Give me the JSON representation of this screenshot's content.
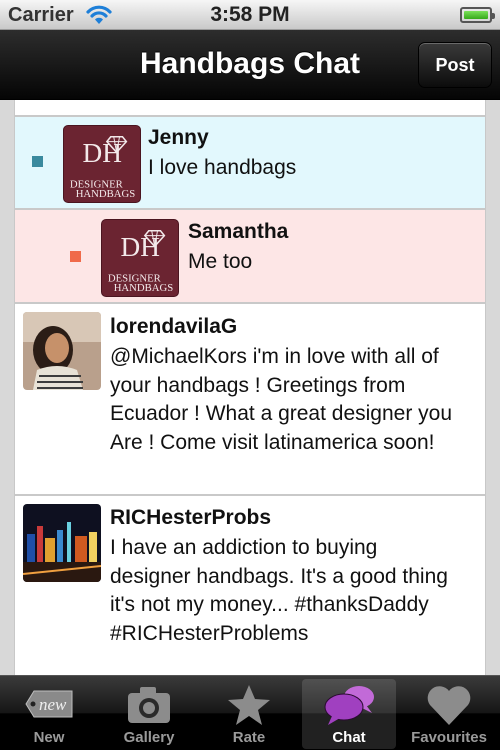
{
  "status_bar": {
    "carrier": "Carrier",
    "time": "3:58 PM"
  },
  "nav": {
    "title": "Handbags Chat",
    "post_label": "Post"
  },
  "logo_text": {
    "monogram": "DH",
    "line1": "DESIGNER",
    "line2": "HANDBAGS"
  },
  "messages": [
    {
      "name": "Jenny",
      "text": "I love handbags",
      "bullet_color": "#3a8a9e",
      "avatar": "designer-handbags-logo"
    },
    {
      "name": "Samantha",
      "text": "Me too",
      "bullet_color": "#f06a4a",
      "avatar": "designer-handbags-logo"
    },
    {
      "name": "lorendavilaG",
      "text_lines": [
        "@MichaelKors i'm in love with all of",
        "your handbags ! Greetings from",
        "Ecuador ! What a great designer you",
        "Are ! Come visit latinamerica soon!"
      ],
      "avatar": "user-photo"
    },
    {
      "name": "RICHesterProbs",
      "text_lines": [
        "I have an addiction to buying",
        "designer handbags. It's a good thing",
        "it's not my money... #thanksDaddy",
        "#RICHesterProblems"
      ],
      "avatar": "city-night-photo"
    }
  ],
  "tabs": [
    {
      "label": "New",
      "icon": "new-tag-icon",
      "active": false
    },
    {
      "label": "Gallery",
      "icon": "camera-icon",
      "active": false
    },
    {
      "label": "Rate",
      "icon": "star-icon",
      "active": false
    },
    {
      "label": "Chat",
      "icon": "chat-bubbles-icon",
      "active": true
    },
    {
      "label": "Favourites",
      "icon": "heart-icon",
      "active": false
    }
  ],
  "new_tag_text": "new",
  "colors": {
    "chat_active": "#a040c0",
    "list_blue": "#e2f8fd",
    "list_pink": "#fde6e6",
    "logo_bg": "#6b2431"
  }
}
